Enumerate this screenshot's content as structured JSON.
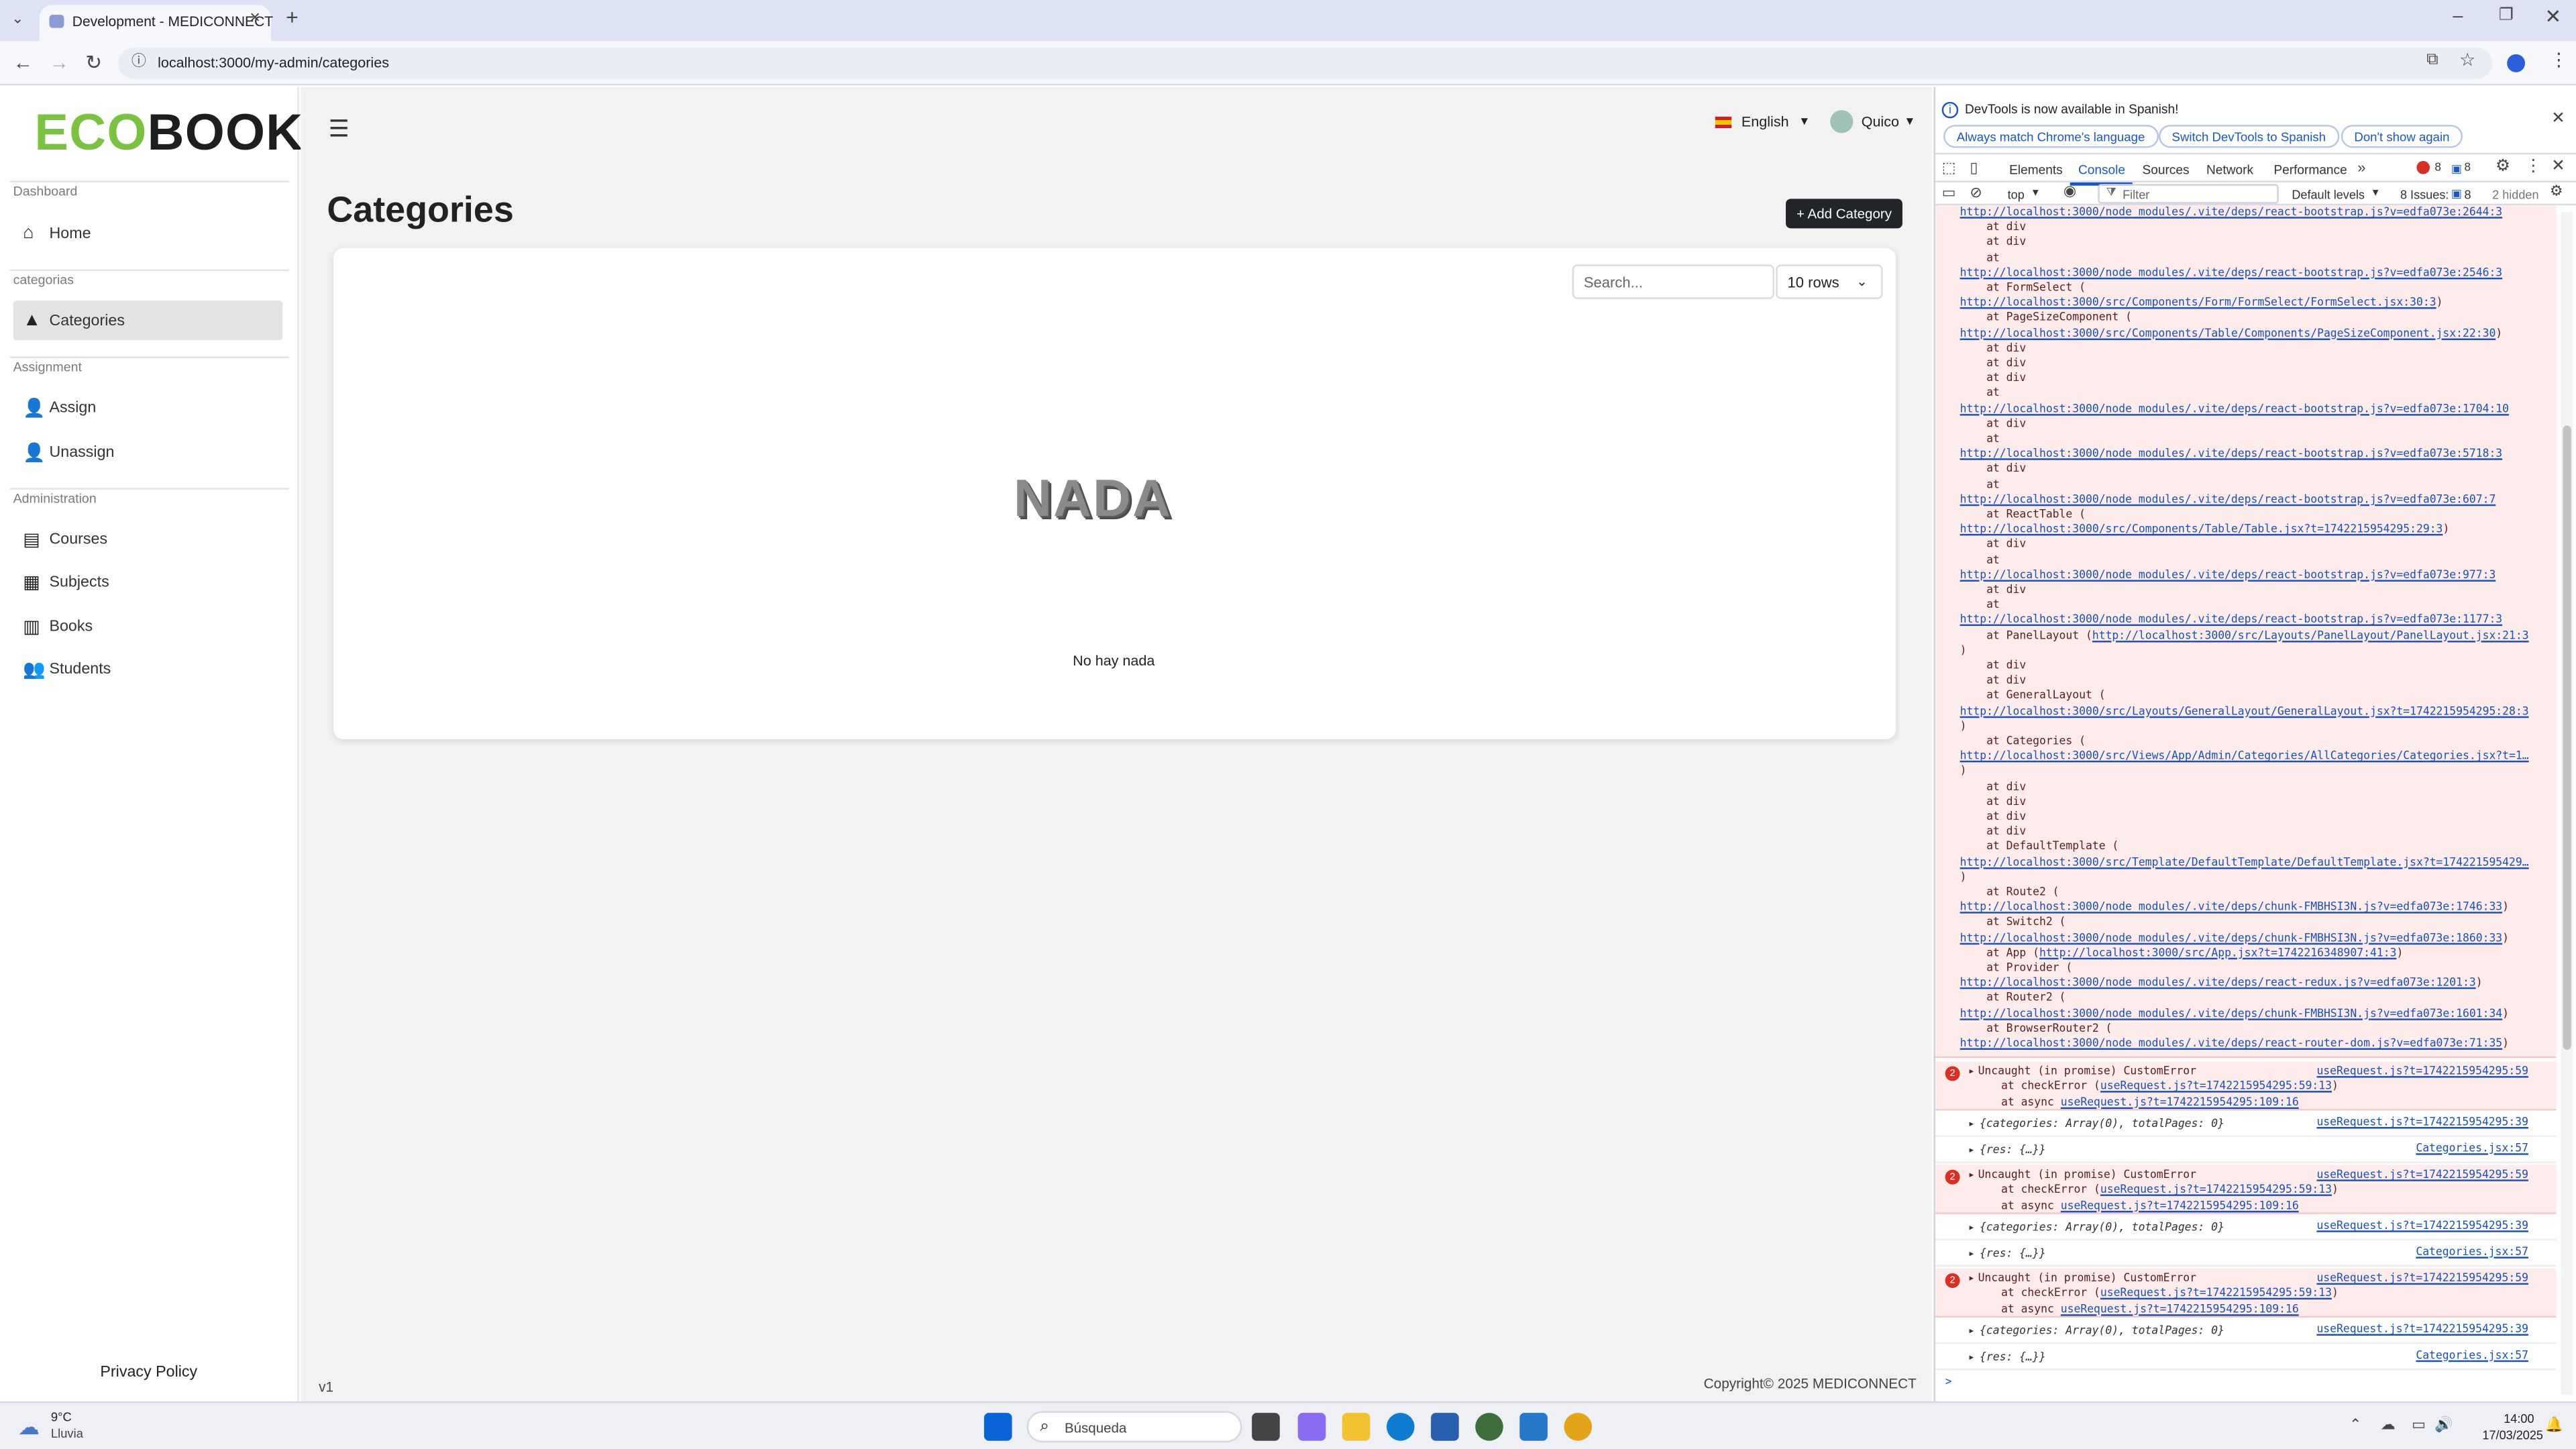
{
  "browser": {
    "tab_title": "Development - MEDICONNECT",
    "url": "localhost:3000/my-admin/categories",
    "close_icon": "×",
    "new_tab_icon": "+"
  },
  "app": {
    "logo": {
      "eco": "ECO",
      "book": "BOOK",
      "eco_color": "#7cc242",
      "book_color": "#1e1e1e"
    },
    "sidebar": {
      "sections": [
        {
          "label": "Dashboard",
          "items": [
            {
              "label": "Home",
              "icon": "home-icon"
            }
          ]
        },
        {
          "label": "categorias",
          "items": [
            {
              "label": "Categories",
              "icon": "shapes-icon",
              "active": true
            }
          ]
        },
        {
          "label": "Assignment",
          "items": [
            {
              "label": "Assign",
              "icon": "user-plus-icon"
            },
            {
              "label": "Unassign",
              "icon": "user-minus-icon"
            }
          ]
        },
        {
          "label": "Administration",
          "items": [
            {
              "label": "Courses",
              "icon": "courses-icon"
            },
            {
              "label": "Subjects",
              "icon": "subjects-icon"
            },
            {
              "label": "Books",
              "icon": "books-icon"
            },
            {
              "label": "Students",
              "icon": "students-icon"
            }
          ]
        }
      ],
      "privacy": "Privacy Policy"
    },
    "header": {
      "language": "English",
      "user": "Quico"
    },
    "page_title": "Categories",
    "add_button": "+ Add Category",
    "search_placeholder": "Search...",
    "rows_select": "10 rows",
    "empty_image_text": "NADA",
    "empty_message": "No hay nada",
    "footer_version": "v1",
    "footer_copyright": "Copyright© 2025 MEDICONNECT"
  },
  "devtools": {
    "notice": "DevTools is now available in Spanish!",
    "notice_buttons": [
      "Always match Chrome's language",
      "Switch DevTools to Spanish",
      "Don't show again"
    ],
    "tabs": [
      "Elements",
      "Console",
      "Sources",
      "Network",
      "Performance"
    ],
    "active_tab": "Console",
    "error_count": "8",
    "message_count": "8",
    "context": "top",
    "filter_placeholder": "Filter",
    "levels": "Default levels",
    "issues_label": "8 Issues:",
    "issues_count": "8",
    "hidden": "2 hidden",
    "stack_lines": [
      {
        "t": "",
        "l": "http://localhost:3000/node_modules/.vite/deps/react-bootstrap.js?v=edfa073e:2644:3"
      },
      {
        "t": "    at div"
      },
      {
        "t": "    at div"
      },
      {
        "t": "    at"
      },
      {
        "t": "",
        "l": "http://localhost:3000/node_modules/.vite/deps/react-bootstrap.js?v=edfa073e:2546:3"
      },
      {
        "t": "    at FormSelect ("
      },
      {
        "t": "",
        "l": "http://localhost:3000/src/Components/Form/FormSelect/FormSelect.jsx:30:3",
        "s": ")"
      },
      {
        "t": "    at PageSizeComponent ("
      },
      {
        "t": "",
        "l": "http://localhost:3000/src/Components/Table/Components/PageSizeComponent.jsx:22:30",
        "s": ")"
      },
      {
        "t": "    at div"
      },
      {
        "t": "    at div"
      },
      {
        "t": "    at div"
      },
      {
        "t": "    at"
      },
      {
        "t": "",
        "l": "http://localhost:3000/node_modules/.vite/deps/react-bootstrap.js?v=edfa073e:1704:10"
      },
      {
        "t": "    at div"
      },
      {
        "t": "    at"
      },
      {
        "t": "",
        "l": "http://localhost:3000/node_modules/.vite/deps/react-bootstrap.js?v=edfa073e:5718:3"
      },
      {
        "t": "    at div"
      },
      {
        "t": "    at"
      },
      {
        "t": "",
        "l": "http://localhost:3000/node_modules/.vite/deps/react-bootstrap.js?v=edfa073e:607:7"
      },
      {
        "t": "    at ReactTable ("
      },
      {
        "t": "",
        "l": "http://localhost:3000/src/Components/Table/Table.jsx?t=1742215954295:29:3",
        "s": ")"
      },
      {
        "t": "    at div"
      },
      {
        "t": "    at"
      },
      {
        "t": "",
        "l": "http://localhost:3000/node_modules/.vite/deps/react-bootstrap.js?v=edfa073e:977:3"
      },
      {
        "t": "    at div"
      },
      {
        "t": "    at"
      },
      {
        "t": "",
        "l": "http://localhost:3000/node_modules/.vite/deps/react-bootstrap.js?v=edfa073e:1177:3"
      },
      {
        "t": "    at PanelLayout (",
        "l": "http://localhost:3000/src/Layouts/PanelLayout/PanelLayout.jsx:21:3"
      },
      {
        "t": ")"
      },
      {
        "t": "    at div"
      },
      {
        "t": "    at div"
      },
      {
        "t": "    at GeneralLayout ("
      },
      {
        "t": "",
        "l": "http://localhost:3000/src/Layouts/GeneralLayout/GeneralLayout.jsx?t=1742215954295:28:3"
      },
      {
        "t": ")"
      },
      {
        "t": "    at Categories ("
      },
      {
        "t": "",
        "l": "http://localhost:3000/src/Views/App/Admin/Categories/AllCategories/Categories.jsx?t=1…"
      },
      {
        "t": ")"
      },
      {
        "t": "    at div"
      },
      {
        "t": "    at div"
      },
      {
        "t": "    at div"
      },
      {
        "t": "    at div"
      },
      {
        "t": "    at DefaultTemplate ("
      },
      {
        "t": "",
        "l": "http://localhost:3000/src/Template/DefaultTemplate/DefaultTemplate.jsx?t=174221595429…"
      },
      {
        "t": ")"
      },
      {
        "t": "    at Route2 ("
      },
      {
        "t": "",
        "l": "http://localhost:3000/node_modules/.vite/deps/chunk-FMBHSI3N.js?v=edfa073e:1746:33",
        "s": ")"
      },
      {
        "t": "    at Switch2 ("
      },
      {
        "t": "",
        "l": "http://localhost:3000/node_modules/.vite/deps/chunk-FMBHSI3N.js?v=edfa073e:1860:33",
        "s": ")"
      },
      {
        "t": "    at App (",
        "l": "http://localhost:3000/src/App.jsx?t=1742216348907:41:3",
        "s": ")"
      },
      {
        "t": "    at Provider ("
      },
      {
        "t": "",
        "l": "http://localhost:3000/node_modules/.vite/deps/react-redux.js?v=edfa073e:1201:3",
        "s": ")"
      },
      {
        "t": "    at Router2 ("
      },
      {
        "t": "",
        "l": "http://localhost:3000/node_modules/.vite/deps/chunk-FMBHSI3N.js?v=edfa073e:1601:34",
        "s": ")"
      },
      {
        "t": "    at BrowserRouter2 ("
      },
      {
        "t": "",
        "l": "http://localhost:3000/node_modules/.vite/deps/react-router-dom.js?v=edfa073e:71:35",
        "s": ")"
      }
    ],
    "repeat_groups": [
      {
        "error": "Uncaught (in promise) CustomError",
        "error_src": "useRequest.js?t=1742215954295:59",
        "check_prefix": "  at checkError (",
        "check_link": "useRequest.js?t=1742215954295:59:13",
        "async_prefix": "  at async ",
        "async_link": "useRequest.js?t=1742215954295:109:16",
        "obj1": "{categories: Array(0), totalPages: 0}",
        "obj1_src": "useRequest.js?t=1742215954295:39",
        "obj2": "{res: {…}}",
        "obj2_src": "Categories.jsx:57"
      },
      {
        "error": "Uncaught (in promise) CustomError",
        "error_src": "useRequest.js?t=1742215954295:59",
        "check_prefix": "  at checkError (",
        "check_link": "useRequest.js?t=1742215954295:59:13",
        "async_prefix": "  at async ",
        "async_link": "useRequest.js?t=1742215954295:109:16",
        "obj1": "{categories: Array(0), totalPages: 0}",
        "obj1_src": "useRequest.js?t=1742215954295:39",
        "obj2": "{res: {…}}",
        "obj2_src": "Categories.jsx:57"
      },
      {
        "error": "Uncaught (in promise) CustomError",
        "error_src": "useRequest.js?t=1742215954295:59",
        "check_prefix": "  at checkError (",
        "check_link": "useRequest.js?t=1742215954295:59:13",
        "async_prefix": "  at async ",
        "async_link": "useRequest.js?t=1742215954295:109:16",
        "obj1": "{categories: Array(0), totalPages: 0}",
        "obj1_src": "useRequest.js?t=1742215954295:39",
        "obj2": "{res: {…}}",
        "obj2_src": "Categories.jsx:57"
      }
    ],
    "prompt_symbol": ">"
  },
  "taskbar": {
    "weather_temp": "9°C",
    "weather_desc": "Lluvia",
    "search_placeholder": "Búsqueda",
    "time": "14:00",
    "date": "17/03/2025",
    "apps": [
      "start-icon",
      "task-view-icon",
      "copilot-icon",
      "file-explorer-icon",
      "edge-icon",
      "store-icon",
      "hs-app-icon",
      "vscode-icon",
      "chrome-icon"
    ],
    "app_colors": [
      "#0a64d8",
      "#444444",
      "#8a6cf0",
      "#f2c230",
      "#0f7cd0",
      "#2a5fb0",
      "#3b6e3b",
      "#2477c9",
      "#e3a31a"
    ]
  }
}
